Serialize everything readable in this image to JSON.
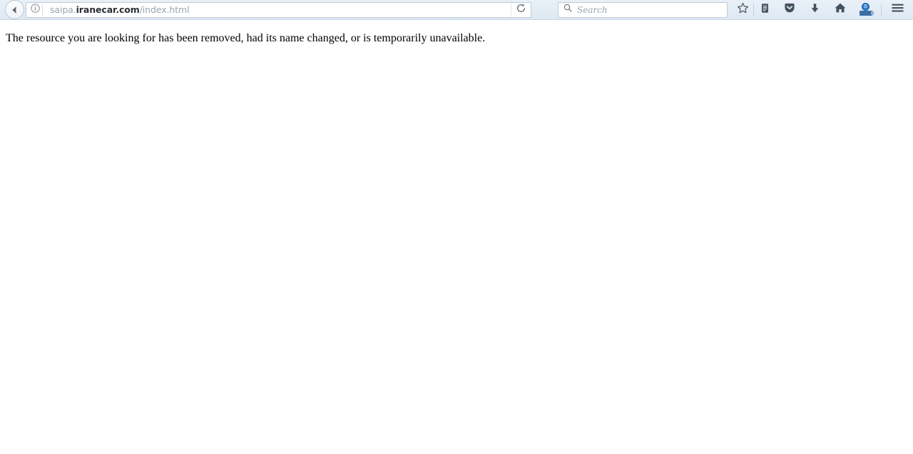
{
  "browser": {
    "back_button": {
      "label": "Back",
      "icon": "arrow-left-icon"
    },
    "address_bar": {
      "identity_icon": "info-circle-icon",
      "url_prefix": "saipa.",
      "url_domain": "iranecar.com",
      "url_path": "/index.html",
      "full_url": "saipa.iranecar.com/index.html",
      "reload_icon": "reload-icon",
      "reload_label": "Reload current page"
    },
    "search_bar": {
      "icon": "search-icon",
      "placeholder": "Search",
      "value": ""
    },
    "toolbar_buttons": [
      {
        "name": "bookmark-star-button",
        "icon": "star-icon",
        "label": "Bookmark this page"
      },
      {
        "name": "reading-list-button",
        "icon": "reading-list-icon",
        "label": "Reading list"
      },
      {
        "name": "pocket-button",
        "icon": "pocket-icon",
        "label": "Save to Pocket"
      },
      {
        "name": "downloads-button",
        "icon": "download-arrow-icon",
        "label": "Downloads"
      },
      {
        "name": "home-button",
        "icon": "home-icon",
        "label": "Home"
      },
      {
        "name": "extension-button",
        "icon": "extension-icon",
        "label": "Extension",
        "badge": "0"
      },
      {
        "name": "menu-button",
        "icon": "hamburger-menu-icon",
        "label": "Open menu"
      }
    ],
    "colors": {
      "toolbar_top": "#e9f0f7",
      "toolbar_bottom": "#dfe9f3",
      "toolbar_border": "#b6c4d2",
      "field_background": "#ffffff",
      "field_border": "#bfcbd7",
      "icon": "#44525f",
      "placeholder_text": "#9aa3ab",
      "domain_text": "#2b2f33",
      "extension_badge": "#2f7fd0",
      "page_background": "#ffffff",
      "page_text": "#000000"
    }
  },
  "page": {
    "message": "The resource you are looking for has been removed, had its name changed, or is temporarily unavailable."
  }
}
